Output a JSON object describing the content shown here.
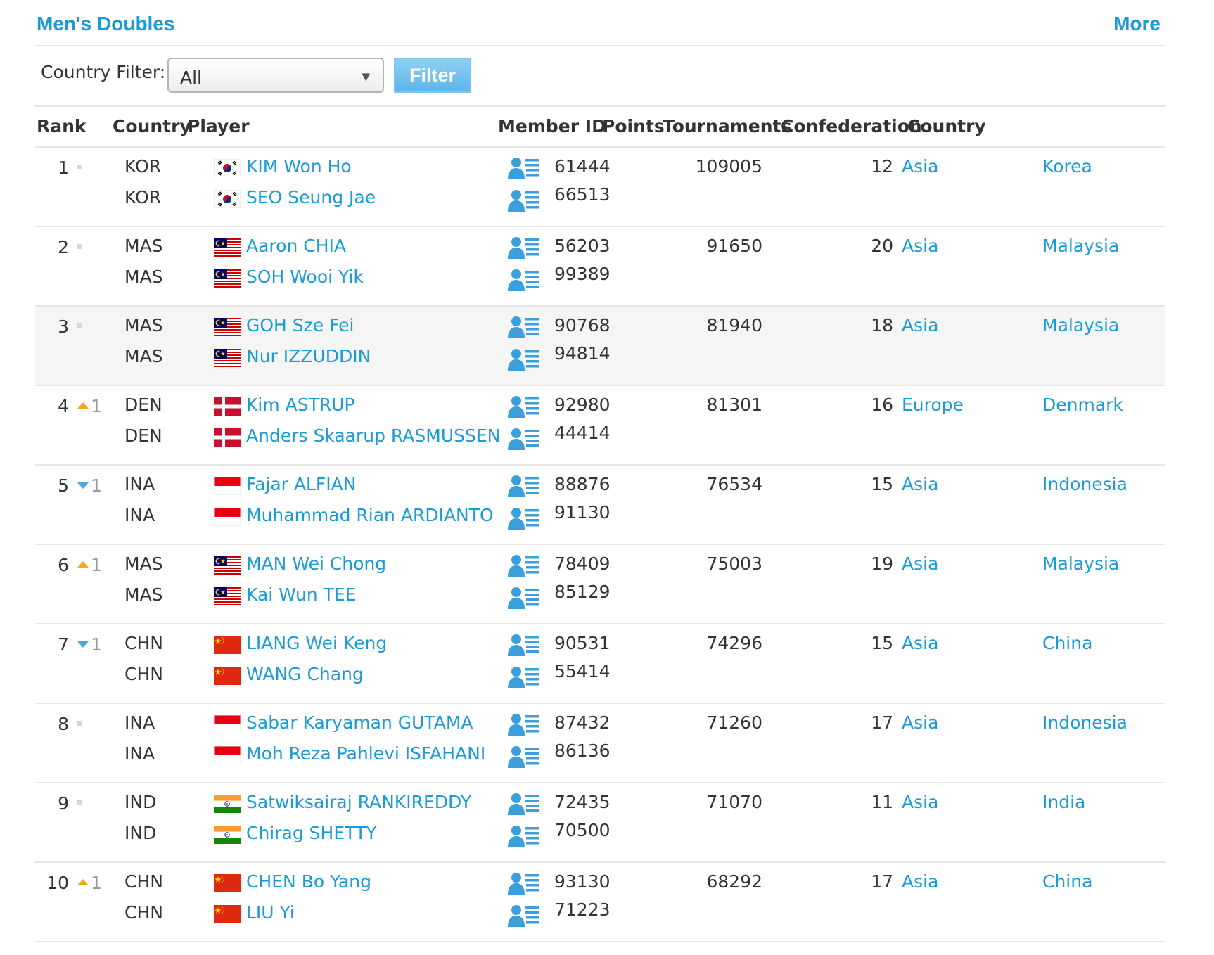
{
  "section": {
    "title": "Men's Doubles",
    "more": "More"
  },
  "filter": {
    "label": "Country Filter:",
    "selected": "All",
    "button": "Filter"
  },
  "colors": {
    "link": "#1a9ad6",
    "up": "#f5a623",
    "down": "#4aa8e0"
  },
  "headers": {
    "rank": "Rank",
    "country": "Country",
    "player": "Player",
    "member_id": "Member ID",
    "points": "Points",
    "tournaments": "Tournaments",
    "confederation": "Confederation",
    "country2": "Country"
  },
  "rows": [
    {
      "rank": "1",
      "change_dir": "same",
      "change": "",
      "points": "109005",
      "tournaments": "12",
      "confederation": "Asia",
      "country": "Korea",
      "flag": "kor",
      "players": [
        {
          "code": "KOR",
          "name": "KIM Won Ho",
          "id": "61444"
        },
        {
          "code": "KOR",
          "name": "SEO Seung Jae",
          "id": "66513"
        }
      ]
    },
    {
      "rank": "2",
      "change_dir": "same",
      "change": "",
      "points": "91650",
      "tournaments": "20",
      "confederation": "Asia",
      "country": "Malaysia",
      "flag": "mas",
      "players": [
        {
          "code": "MAS",
          "name": "Aaron CHIA",
          "id": "56203"
        },
        {
          "code": "MAS",
          "name": "SOH Wooi Yik",
          "id": "99389"
        }
      ]
    },
    {
      "rank": "3",
      "change_dir": "same",
      "change": "",
      "points": "81940",
      "tournaments": "18",
      "confederation": "Asia",
      "country": "Malaysia",
      "flag": "mas",
      "players": [
        {
          "code": "MAS",
          "name": "GOH Sze Fei",
          "id": "90768"
        },
        {
          "code": "MAS",
          "name": "Nur IZZUDDIN",
          "id": "94814"
        }
      ]
    },
    {
      "rank": "4",
      "change_dir": "up",
      "change": "1",
      "points": "81301",
      "tournaments": "16",
      "confederation": "Europe",
      "country": "Denmark",
      "flag": "den",
      "players": [
        {
          "code": "DEN",
          "name": "Kim ASTRUP",
          "id": "92980"
        },
        {
          "code": "DEN",
          "name": "Anders Skaarup RASMUSSEN",
          "id": "44414"
        }
      ]
    },
    {
      "rank": "5",
      "change_dir": "down",
      "change": "1",
      "points": "76534",
      "tournaments": "15",
      "confederation": "Asia",
      "country": "Indonesia",
      "flag": "ina",
      "players": [
        {
          "code": "INA",
          "name": "Fajar ALFIAN",
          "id": "88876"
        },
        {
          "code": "INA",
          "name": "Muhammad Rian ARDIANTO",
          "id": "91130"
        }
      ]
    },
    {
      "rank": "6",
      "change_dir": "up",
      "change": "1",
      "points": "75003",
      "tournaments": "19",
      "confederation": "Asia",
      "country": "Malaysia",
      "flag": "mas",
      "players": [
        {
          "code": "MAS",
          "name": "MAN Wei Chong",
          "id": "78409"
        },
        {
          "code": "MAS",
          "name": "Kai Wun TEE",
          "id": "85129"
        }
      ]
    },
    {
      "rank": "7",
      "change_dir": "down",
      "change": "1",
      "points": "74296",
      "tournaments": "15",
      "confederation": "Asia",
      "country": "China",
      "flag": "chn",
      "players": [
        {
          "code": "CHN",
          "name": "LIANG Wei Keng",
          "id": "90531"
        },
        {
          "code": "CHN",
          "name": "WANG Chang",
          "id": "55414"
        }
      ]
    },
    {
      "rank": "8",
      "change_dir": "same",
      "change": "",
      "points": "71260",
      "tournaments": "17",
      "confederation": "Asia",
      "country": "Indonesia",
      "flag": "ina",
      "players": [
        {
          "code": "INA",
          "name": "Sabar Karyaman GUTAMA",
          "id": "87432"
        },
        {
          "code": "INA",
          "name": "Moh Reza Pahlevi ISFAHANI",
          "id": "86136"
        }
      ]
    },
    {
      "rank": "9",
      "change_dir": "same",
      "change": "",
      "points": "71070",
      "tournaments": "11",
      "confederation": "Asia",
      "country": "India",
      "flag": "ind",
      "players": [
        {
          "code": "IND",
          "name": "Satwiksairaj RANKIREDDY",
          "id": "72435"
        },
        {
          "code": "IND",
          "name": "Chirag SHETTY",
          "id": "70500"
        }
      ]
    },
    {
      "rank": "10",
      "change_dir": "up",
      "change": "1",
      "points": "68292",
      "tournaments": "17",
      "confederation": "Asia",
      "country": "China",
      "flag": "chn",
      "players": [
        {
          "code": "CHN",
          "name": "CHEN Bo Yang",
          "id": "93130"
        },
        {
          "code": "CHN",
          "name": "LIU Yi",
          "id": "71223"
        }
      ]
    }
  ]
}
